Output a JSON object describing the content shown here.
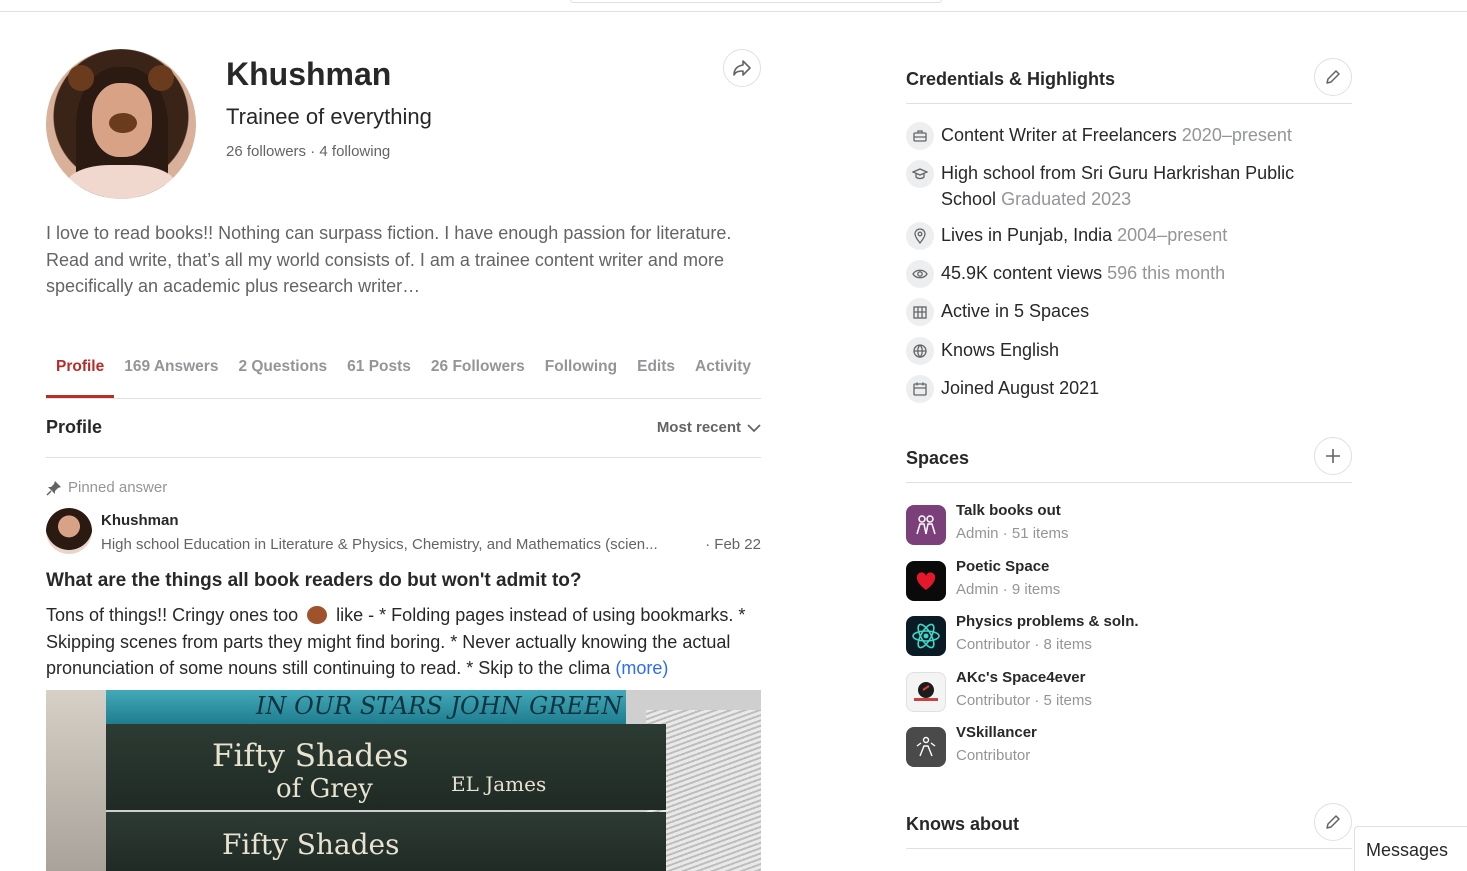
{
  "profile": {
    "name": "Khushman",
    "tagline": "Trainee of everything",
    "followers_text": "26 followers",
    "separator": "·",
    "following_text": "4 following",
    "bio": "I love to read books!! Nothing can surpass fiction. I have enough passion for literature. Read and write, that’s all my world consists of. I am a trainee content writer and more specifically an academic plus research writer…"
  },
  "tabs": [
    {
      "label": "Profile",
      "active": true
    },
    {
      "label": "169 Answers"
    },
    {
      "label": "2 Questions"
    },
    {
      "label": "61 Posts"
    },
    {
      "label": "26 Followers"
    },
    {
      "label": "Following"
    },
    {
      "label": "Edits"
    },
    {
      "label": "Activity"
    }
  ],
  "section": {
    "title": "Profile",
    "sort_label": "Most recent"
  },
  "pinned_answer": {
    "pinned_label": "Pinned answer",
    "author_name": "Khushman",
    "author_credential": "High school Education in Literature & Physics, Chemistry, and Mathematics (scien...",
    "date": "· Feb 22",
    "question": "What are the things all book readers do but won't admit to?",
    "answer_part1": "Tons of things!! Cringy ones too",
    "answer_part2": "like - * Folding pages instead of using bookmarks. * Skipping scenes from parts they might find boring. * Never actually knowing the actual pronunciation of some nouns still continuing to read. * Skip to the clima",
    "more_label": "(more)",
    "image_texts": {
      "top_book": "IN OUR STARS   JOHN GREEN",
      "book2_title_line1": "Fifty Shades",
      "book2_title_line2": "of Grey",
      "book2_author": "EL James",
      "book3_title": "Fifty Shades"
    }
  },
  "credentials": {
    "title": "Credentials & Highlights",
    "items": [
      {
        "icon": "briefcase-icon",
        "text": "Content Writer at Freelancers",
        "muted": "2020–present"
      },
      {
        "icon": "graduation-cap-icon",
        "text": "High school from Sri Guru Harkrishan Public School",
        "muted": "Graduated 2023"
      },
      {
        "icon": "location-pin-icon",
        "text": "Lives in Punjab, India",
        "muted": "2004–present"
      },
      {
        "icon": "eye-icon",
        "text": "45.9K content views",
        "muted": "596 this month"
      },
      {
        "icon": "spaces-icon",
        "text": "Active in 5 Spaces",
        "muted": ""
      },
      {
        "icon": "globe-icon",
        "text": "Knows English",
        "muted": ""
      },
      {
        "icon": "calendar-icon",
        "text": "Joined August 2021",
        "muted": ""
      }
    ]
  },
  "spaces": {
    "title": "Spaces",
    "items": [
      {
        "name": "Talk books out",
        "meta": "Admin · 51 items",
        "color": "#7b3f7a"
      },
      {
        "name": "Poetic Space",
        "meta": "Admin · 9 items",
        "color": "#0a0a0a"
      },
      {
        "name": "Physics problems & soln.",
        "meta": "Contributor · 8 items",
        "color": "#0b1b26"
      },
      {
        "name": "AKc's Space4ever",
        "meta": "Contributor · 5 items",
        "color": "#f4f4f4"
      },
      {
        "name": "VSkillancer",
        "meta": "Contributor",
        "color": "#4a4a4a"
      }
    ]
  },
  "knows_about": {
    "title": "Knows about"
  },
  "messages": {
    "label": "Messages"
  },
  "colors": {
    "accent": "#b92b27",
    "link": "#2e69ff",
    "muted": "#939598",
    "text": "#282829",
    "border": "#dee0e1"
  }
}
